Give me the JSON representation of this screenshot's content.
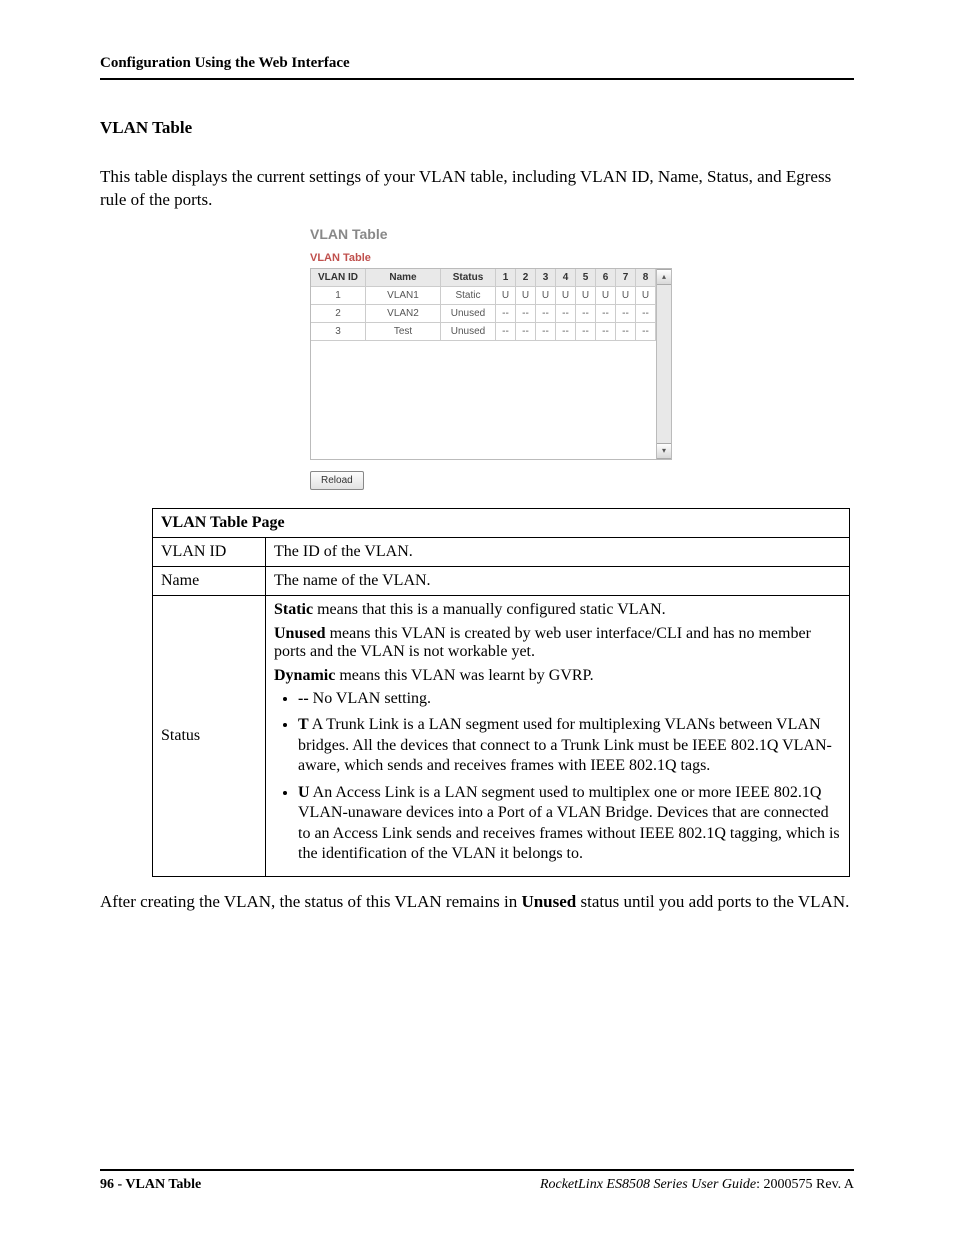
{
  "header": {
    "running": "Configuration Using the Web Interface"
  },
  "section": {
    "title": "VLAN Table"
  },
  "intro": "This table displays the current settings of your VLAN table, including VLAN ID, Name, Status, and Egress rule of the ports.",
  "shot": {
    "title": "VLAN Table",
    "subtitle": "VLAN Table",
    "headers": [
      "VLAN ID",
      "Name",
      "Status",
      "1",
      "2",
      "3",
      "4",
      "5",
      "6",
      "7",
      "8"
    ],
    "rows": [
      {
        "id": "1",
        "name": "VLAN1",
        "status": "Static",
        "ports": [
          "U",
          "U",
          "U",
          "U",
          "U",
          "U",
          "U",
          "U"
        ]
      },
      {
        "id": "2",
        "name": "VLAN2",
        "status": "Unused",
        "ports": [
          "--",
          "--",
          "--",
          "--",
          "--",
          "--",
          "--",
          "--"
        ]
      },
      {
        "id": "3",
        "name": "Test",
        "status": "Unused",
        "ports": [
          "--",
          "--",
          "--",
          "--",
          "--",
          "--",
          "--",
          "--"
        ]
      }
    ],
    "reload": "Reload"
  },
  "spec": {
    "caption": "VLAN Table Page",
    "rows": {
      "vlan_id": {
        "label": "VLAN ID",
        "text": "The ID of the VLAN."
      },
      "name": {
        "label": "Name",
        "text": "The name of the VLAN."
      },
      "status": {
        "label": "Status",
        "static_label": "Static",
        "static_text": " means that this is a manually configured static VLAN.",
        "unused_label": "Unused",
        "unused_text": " means this VLAN is created by web user interface/CLI and has no member ports and the VLAN is not workable yet.",
        "dynamic_label": "Dynamic",
        "dynamic_text": " means this VLAN was learnt by GVRP.",
        "bul_none_label": "--",
        "bul_none_text": "  No VLAN setting.",
        "bul_t_label": "T",
        "bul_t_text": "  A Trunk Link is a LAN segment used for multiplexing VLANs between VLAN bridges. All the devices that connect to a Trunk Link must be IEEE 802.1Q VLAN-aware, which sends and receives frames with IEEE 802.1Q tags.",
        "bul_u_label": "U",
        "bul_u_text": " An Access Link is a LAN segment used to multiplex one or more IEEE 802.1Q VLAN-unaware devices into a Port of a VLAN Bridge. Devices that are connected to an Access Link sends and receives frames without IEEE 802.1Q tagging, which is the identification of the VLAN it belongs to."
      }
    }
  },
  "after_note_pre": "After creating the VLAN, the status of this VLAN remains in ",
  "after_note_bold": "Unused",
  "after_note_post": " status until you add ports to the VLAN.",
  "footer": {
    "left_page": "96 - VLAN Table",
    "right_italic": "RocketLinx ES8508 Series  User Guide",
    "right_rev": ": 2000575 Rev. A"
  }
}
